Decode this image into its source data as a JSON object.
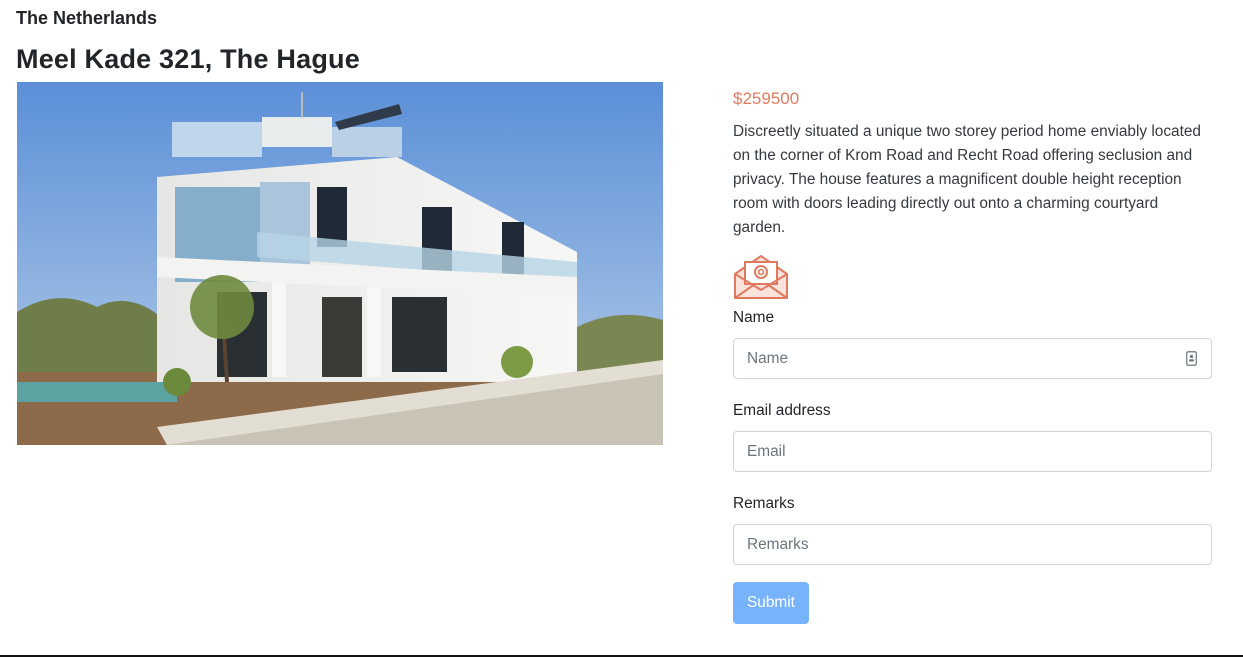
{
  "listing": {
    "country": "The Netherlands",
    "address": "Meel Kade 321, The Hague",
    "price": "$259500",
    "description": "Discreetly situated a unique two storey period home enviably located on the corner of Krom Road and Recht Road offering seclusion and privacy. The house features a magnificent double height reception room with doors leading directly out onto a charming courtyard garden."
  },
  "photo": {
    "icon": "house-photo"
  },
  "contact_form": {
    "icon": "envelope-at-icon",
    "name_label": "Name",
    "name_placeholder": "Name",
    "name_value": "",
    "email_label": "Email address",
    "email_placeholder": "Email",
    "email_value": "",
    "remarks_label": "Remarks",
    "remarks_placeholder": "Remarks",
    "remarks_value": "",
    "submit_label": "Submit"
  },
  "colors": {
    "accent": "#e07a5f",
    "button": "#76b3fa",
    "border": "#ced4da"
  }
}
